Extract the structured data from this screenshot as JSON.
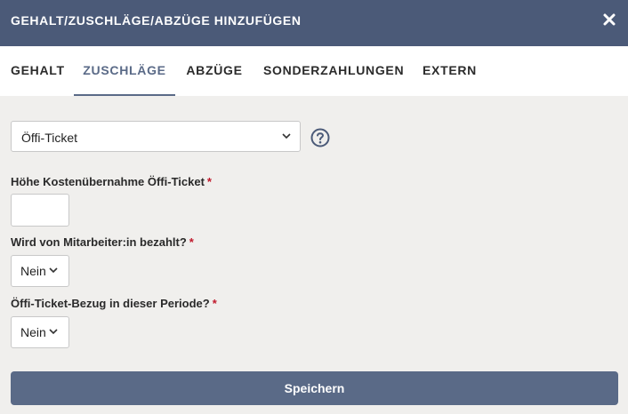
{
  "header": {
    "title": "GEHALT/ZUSCHLÄGE/ABZÜGE HINZUFÜGEN",
    "close_icon": "close-icon"
  },
  "tabs": [
    {
      "label": "GEHALT",
      "active": false
    },
    {
      "label": "ZUSCHLÄGE",
      "active": true
    },
    {
      "label": "ABZÜGE",
      "active": false
    },
    {
      "label": "SONDERZAHLUNGEN",
      "active": false
    },
    {
      "label": "EXTERN",
      "active": false
    }
  ],
  "form": {
    "type_select": {
      "value": "Öffi-Ticket",
      "icon": "chevron-down-icon"
    },
    "help_icon": "help-circle-icon",
    "fields": [
      {
        "label": "Höhe Kostenübernahme Öffi-Ticket",
        "required_mark": "*",
        "value": ""
      },
      {
        "label": "Wird von Mitarbeiter:in bezahlt?",
        "required_mark": "*",
        "value": "Nein"
      },
      {
        "label": "Öffi-Ticket-Bezug in dieser Periode?",
        "required_mark": "*",
        "value": "Nein"
      }
    ]
  },
  "footer": {
    "save_label": "Speichern"
  },
  "colors": {
    "header_bg": "#4b5a78",
    "accent": "#5a6a87",
    "page_bg": "#f0efed",
    "required": "#c0192c"
  }
}
